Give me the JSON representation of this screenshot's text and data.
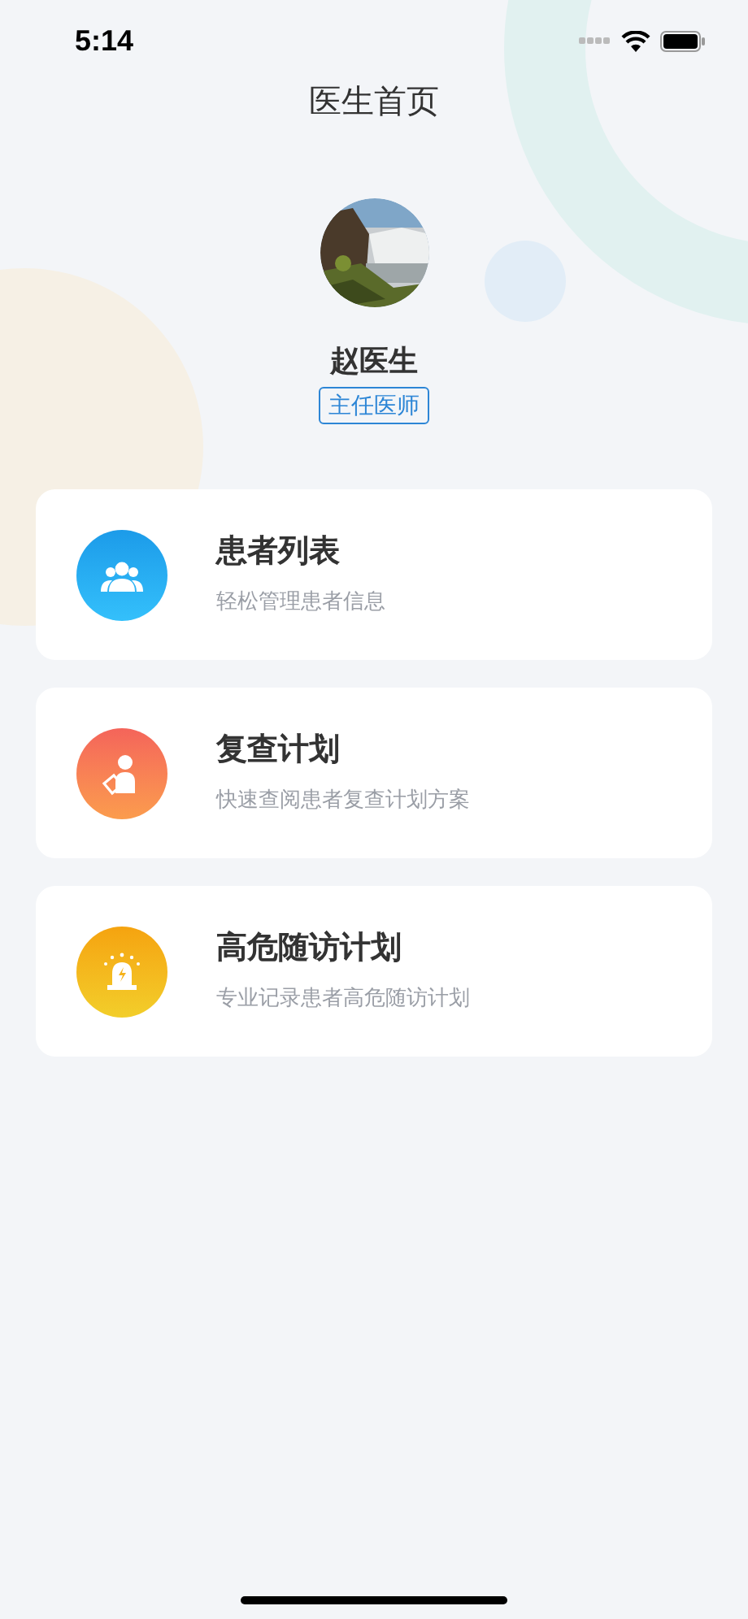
{
  "status_bar": {
    "time": "5:14"
  },
  "header": {
    "title": "医生首页"
  },
  "profile": {
    "name": "赵医生",
    "role": "主任医师"
  },
  "menu": [
    {
      "kind": "people",
      "title": "患者列表",
      "subtitle": "轻松管理患者信息"
    },
    {
      "kind": "review",
      "title": "复查计划",
      "subtitle": "快速查阅患者复查计划方案"
    },
    {
      "kind": "alarm",
      "title": "高危随访计划",
      "subtitle": "专业记录患者高危随访计划"
    }
  ]
}
